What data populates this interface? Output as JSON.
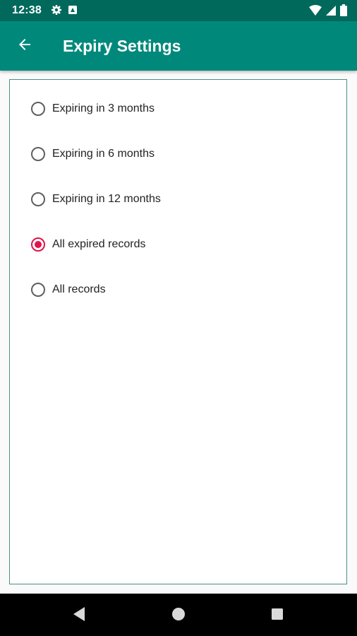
{
  "status_bar": {
    "time": "12:38",
    "left_icons": [
      "settings-icon",
      "notification-icon"
    ],
    "right_icons": [
      "wifi-icon",
      "signal-icon",
      "battery-icon"
    ]
  },
  "app_bar": {
    "title": "Expiry Settings",
    "back_icon": "arrow-back-icon",
    "background": "#00897b",
    "status_background": "#00695c"
  },
  "options": {
    "items": [
      {
        "label": "Expiring in 3 months",
        "checked": false
      },
      {
        "label": "Expiring in 6 months",
        "checked": false
      },
      {
        "label": "Expiring in 12 months",
        "checked": false
      },
      {
        "label": "All expired records",
        "checked": true
      },
      {
        "label": "All records",
        "checked": false
      }
    ],
    "accent": "#e0144c"
  },
  "nav_bar": {
    "buttons": [
      "back-triangle-icon",
      "home-circle-icon",
      "recents-square-icon"
    ]
  }
}
